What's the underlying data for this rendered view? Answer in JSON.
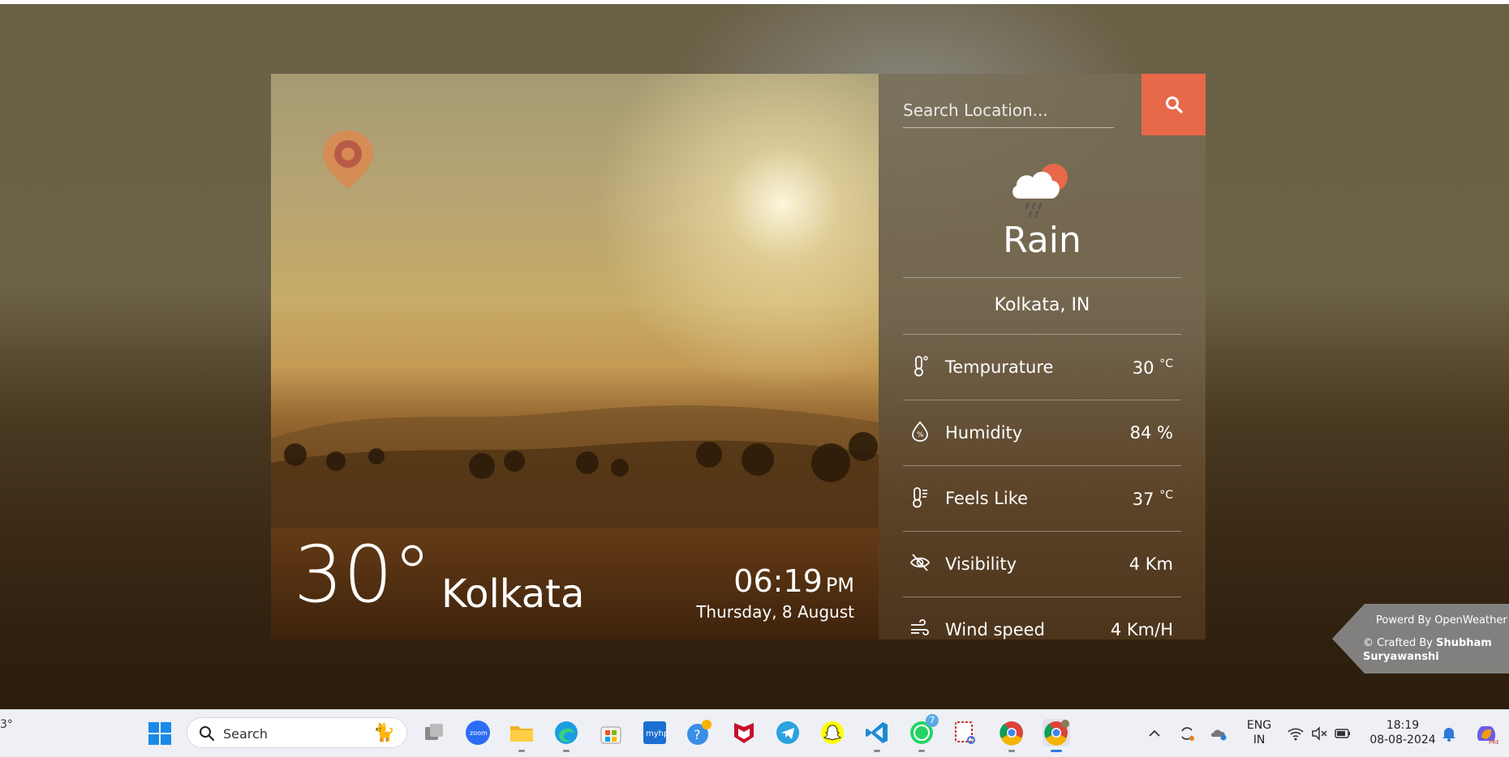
{
  "search": {
    "placeholder": "Search Location..."
  },
  "weather": {
    "condition": "Rain",
    "location": "Kolkata,  IN",
    "temperature_big": "30°",
    "city": "Kolkata",
    "time": "06:19",
    "ampm": "PM",
    "date": "Thursday, 8 August"
  },
  "stats": [
    {
      "label": "Tempurature",
      "value": "30",
      "unit": "°C",
      "icon": "thermometer-icon"
    },
    {
      "label": "Humidity",
      "value": "84 %",
      "unit": "",
      "icon": "humidity-drop-icon"
    },
    {
      "label": "Feels Like",
      "value": "37",
      "unit": "°C",
      "icon": "thermometer-feels-icon"
    },
    {
      "label": "Visibility",
      "value": "4 Km",
      "unit": "",
      "icon": "eye-slash-icon"
    },
    {
      "label": "Wind speed",
      "value": "4 Km/H",
      "unit": "",
      "icon": "wind-icon"
    }
  ],
  "credits": {
    "powered": "Powerd By OpenWeather",
    "crafted_prefix": "© Crafted By ",
    "author": "Shubham Suryawanshi"
  },
  "taskbar": {
    "weather_fragment": "3°",
    "search_label": "Search",
    "whatsapp_badge": "7",
    "lang_top": "ENG",
    "lang_bottom": "IN",
    "clock_time": "18:19",
    "clock_date": "08-08-2024"
  },
  "colors": {
    "accent": "#e8684a",
    "panel": "#766a52",
    "logo": "#d98a52"
  }
}
